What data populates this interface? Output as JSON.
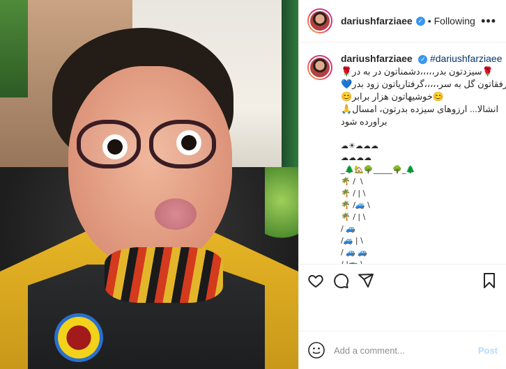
{
  "header": {
    "username": "dariushfarziaee",
    "dot": "•",
    "follow_status": "Following",
    "more": "•••"
  },
  "caption": {
    "username": "dariushfarziaee",
    "hashtag": "#dariushfarziaee",
    "lines": [
      "🌹سیزدتون بدر،،،،،دشمناتون در به در🌹",
      "💙رفقاتون گل به سر،،،،،گرفتاریاتون زود بدر💙",
      "😊خوشیهاتون هزار برابر😊",
      "انشالا... ارزوهای سیزده بدرتون، امسال🙏",
      "براورده شود",
      "",
      "☁☀☁☁☁",
      "☁☁☁☁",
      "_🌲🏡🌳_____🌳_🌲",
      "🌴 /  \\",
      "🌴 / | \\",
      "🌴 /🚙 \\",
      "🌴 / | \\",
      "/ 🚙",
      "/🚙 | \\",
      "/ 🚙 🚙",
      "/ |🚌 \\"
    ]
  },
  "actions": {
    "like": "heart-icon",
    "comment": "comment-icon",
    "share": "share-icon",
    "save": "bookmark-icon"
  },
  "comment_box": {
    "placeholder": "Add a comment...",
    "post_label": "Post"
  },
  "colors": {
    "verified": "#3897f0",
    "hashtag": "#00376b",
    "post_disabled": "#b3dbff"
  }
}
